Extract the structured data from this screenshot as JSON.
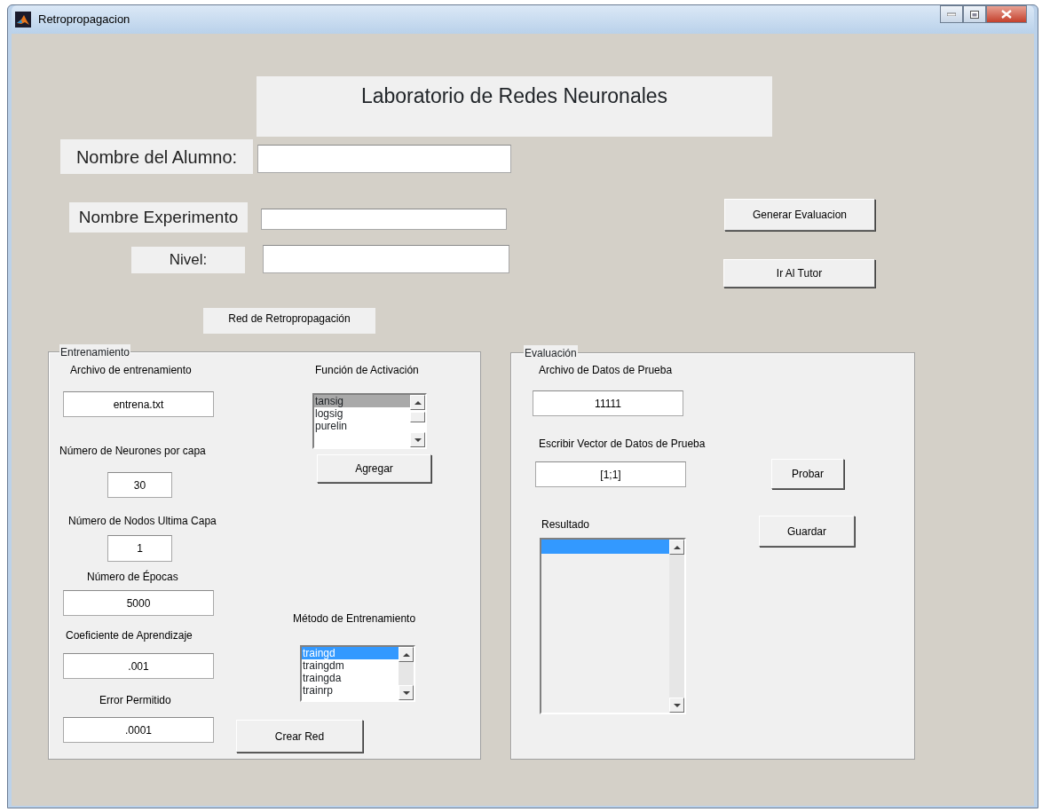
{
  "window": {
    "title": "Retropropagacion"
  },
  "header": {
    "title": "Laboratorio de Redes Neuronales"
  },
  "student_form": [
    {
      "label": "Nombre del Alumno:"
    },
    {
      "label": "Nombre Experimento"
    },
    {
      "label": "Nivel:"
    }
  ],
  "buttons": [
    {
      "label": "Generar Evaluacion"
    },
    {
      "label": "Ir Al Tutor"
    }
  ],
  "section_label": "Red de Retropropagación",
  "training": {
    "title": "Entrenamiento",
    "fields": [
      {
        "label": "Archivo de entrenamiento",
        "value": "entrena.txt"
      },
      {
        "label": "Número de Neurones por capa",
        "value": "30"
      },
      {
        "label": "Número de Nodos Ultima Capa",
        "value": "1"
      },
      {
        "label": "Número de Épocas",
        "value": "5000"
      },
      {
        "label": "Coeficiente de Aprendizaje",
        "value": ".001"
      },
      {
        "label": "Error Permitido",
        "value": ".0001"
      }
    ],
    "activation": {
      "label": "Función de Activación",
      "focused": false,
      "items": [
        {
          "text": "tansig",
          "selected": true
        },
        {
          "text": "logsig",
          "selected": false
        },
        {
          "text": "purelin",
          "selected": false
        }
      ]
    },
    "add_button": "Agregar",
    "method": {
      "label": "Método de Entrenamiento",
      "focused": true,
      "items": [
        {
          "text": "traingd",
          "selected": true
        },
        {
          "text": "traingdm",
          "selected": false
        },
        {
          "text": "traingda",
          "selected": false
        },
        {
          "text": "trainrp",
          "selected": false
        }
      ]
    },
    "create_button": "Crear Red"
  },
  "evaluation": {
    "title": "Evaluación",
    "fields": [
      {
        "label": "Archivo de Datos de Prueba",
        "value": "11111"
      },
      {
        "label": "Escribir Vector de Datos de Prueba",
        "value": "[1;1]"
      }
    ],
    "test_button": "Probar",
    "save_button": "Guardar",
    "result": {
      "label": "Resultado",
      "focused": true,
      "rows": [
        {
          "selected": true
        }
      ]
    }
  }
}
